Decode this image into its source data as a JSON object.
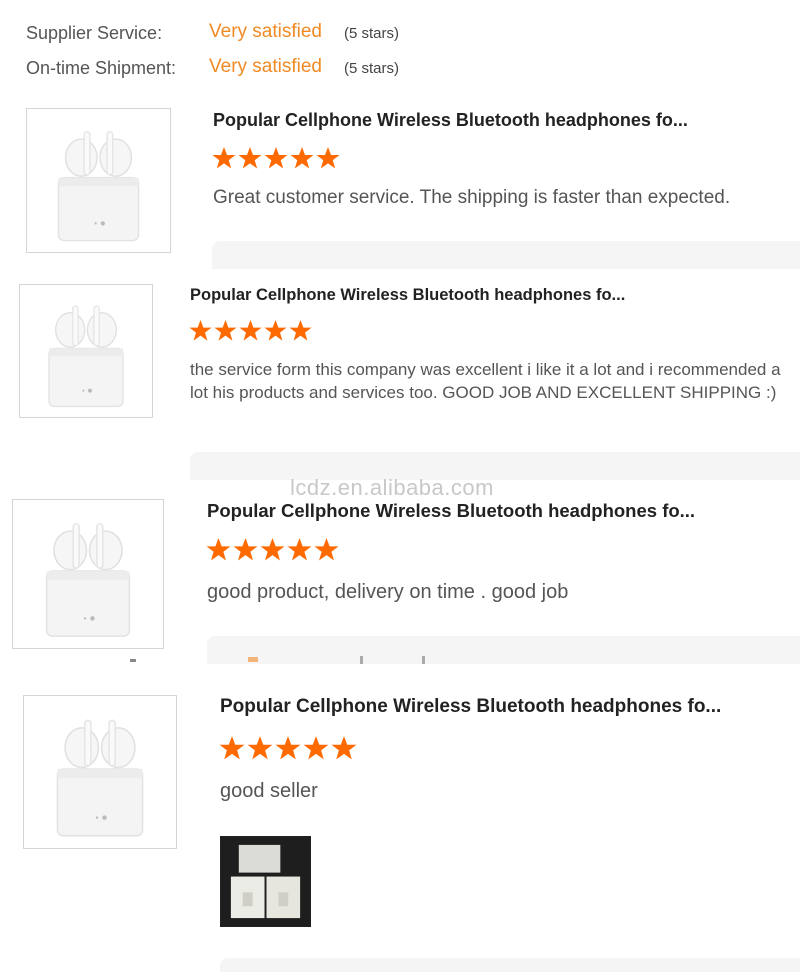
{
  "ratings": [
    {
      "label": "Supplier Service:",
      "value": "Very satisfied",
      "stars": "(5 stars)"
    },
    {
      "label": "On-time Shipment:",
      "value": "Very satisfied",
      "stars": "(5 stars)"
    }
  ],
  "reviews": [
    {
      "title": "Popular Cellphone Wireless Bluetooth headphones fo...",
      "stars": 5,
      "text": "Great customer service. The shipping is faster than expected."
    },
    {
      "title": "Popular Cellphone Wireless Bluetooth headphones fo...",
      "stars": 5,
      "text": "the service form this company was excellent i like it a lot and i recommended a lot his products and services too. GOOD JOB AND EXCELLENT SHIPPING :)"
    },
    {
      "title": "Popular Cellphone Wireless Bluetooth headphones fo...",
      "stars": 5,
      "text": "good product, delivery on time . good job"
    },
    {
      "title": "Popular Cellphone Wireless Bluetooth headphones fo...",
      "stars": 5,
      "text": "good seller"
    }
  ],
  "watermark": "lcdz.en.alibaba.com",
  "colors": {
    "accent": "#f08a24",
    "star": "#ff6a00"
  },
  "icons": {
    "product": "earbuds-case-image",
    "star": "star-icon",
    "photo": "customer-photo"
  }
}
